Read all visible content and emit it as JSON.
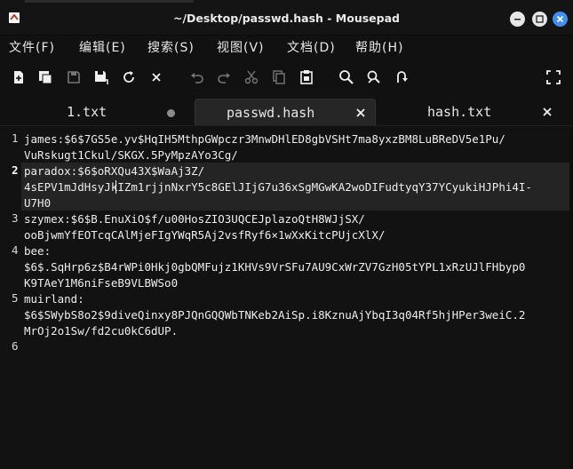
{
  "window": {
    "title": "~/Desktop/passwd.hash - Mousepad"
  },
  "menu": [
    {
      "label": "文件(F)"
    },
    {
      "label": "编辑(E)"
    },
    {
      "label": "搜索(S)"
    },
    {
      "label": "视图(V)"
    },
    {
      "label": "文档(D)"
    },
    {
      "label": "帮助(H)"
    }
  ],
  "toolbar_icons": [
    "new-document-icon",
    "new-window-icon",
    "save-icon",
    "save-as-icon",
    "reload-icon",
    "close-document-icon",
    "undo-icon",
    "redo-icon",
    "cut-icon",
    "copy-icon",
    "paste-icon",
    "search-icon",
    "find-replace-icon",
    "go-to-icon",
    "fullscreen-icon"
  ],
  "tabs": [
    {
      "label": "1.txt",
      "modified": true,
      "active": false
    },
    {
      "label": "passwd.hash",
      "modified": false,
      "active": true
    },
    {
      "label": "hash.txt",
      "modified": false,
      "active": false
    }
  ],
  "editor": {
    "current_line": 2,
    "lines": [
      {
        "number": "1",
        "text": [
          "james:$6$7GS5e.yv$HqIH5MthpGWpczr3MnwDHlED8gbVSHt7ma8yxzBM8LuBReDV5e1Pu/",
          "VuRskugt1Ckul/SKGX.5PyMpzAYo3Cg/"
        ]
      },
      {
        "number": "2",
        "text": [
          "paradox:$6$oRXQu43X$WaAj3Z/",
          "4sEPV1mJdHsyJkIZm1rjjnNxrY5c8GElJIjG7u36xSgMGwKA2woDIFudtyqY37YCyukiHJPhi4I-",
          "U7H0"
        ]
      },
      {
        "number": "3",
        "text": [
          "szymex:$6$B.EnuXiO$f/u00HosZIO3UQCEJplazoQtH8WJjSX/",
          "ooBjwmYfEOTcqCAlMjeFIgYWqR5Aj2vsfRyf6×1wXxKitcPUjcXlX/"
        ]
      },
      {
        "number": "4",
        "text": [
          "bee:",
          "$6$.SqHrp6z$B4rWPi0Hkj0gbQMFujz1KHVs9VrSFu7AU9CxWrZV7GzH05tYPL1xRzUJlFHbyp0",
          "K9TAeY1M6niFseB9VLBWSo0"
        ]
      },
      {
        "number": "5",
        "text": [
          "muirland:",
          "$6$SWybS8o2$9diveQinxy8PJQnGQQWbTNKeb2AiSp.i8KznuAjYbqI3q04Rf5hjHPer3weiC.2",
          "MrOj2o1Sw/fd2cu0kC6dUP."
        ]
      },
      {
        "number": "6",
        "text": []
      }
    ]
  }
}
